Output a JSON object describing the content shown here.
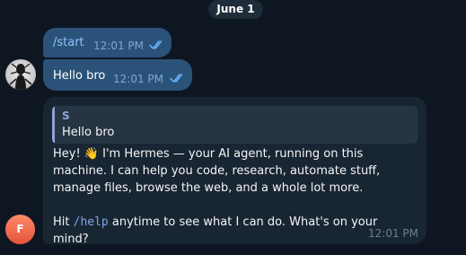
{
  "date_separator": "June 1",
  "outgoing": [
    {
      "text": "/start",
      "time": "12:01 PM",
      "status": "read"
    },
    {
      "text": "Hello bro",
      "time": "12:01 PM",
      "status": "read"
    }
  ],
  "incoming": {
    "reply_to": {
      "sender": "S",
      "text": "Hello bro"
    },
    "line1": "Hey! 👋 I'm Hermes — your AI agent, running on this machine. I can help you code, research, automate stuff, manage files, browse the web, and a whole lot more.",
    "line2_prefix": "Hit ",
    "line2_code": "/help",
    "line2_suffix": " anytime to see what I can do. What's on your mind?",
    "time": "12:01 PM"
  },
  "avatars": {
    "user": {
      "icon": "dark-figure-avatar"
    },
    "bot": {
      "initial": "F",
      "color": "#e5533d"
    }
  },
  "colors": {
    "background": "#0e1621",
    "outgoing_bubble": "#2b5278",
    "incoming_bubble": "#182533",
    "accent": "#8fa3d6"
  }
}
